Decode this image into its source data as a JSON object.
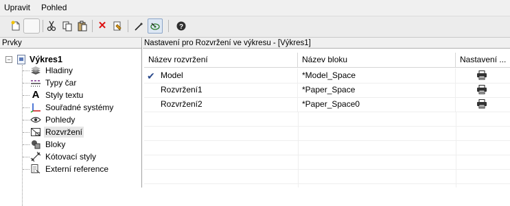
{
  "menu": {
    "items": [
      "Upravit",
      "Pohled"
    ]
  },
  "toolbar": {
    "buttons": [
      "new-icon",
      "blank-button",
      "cut-icon",
      "copy-icon",
      "paste-icon",
      "delete-icon",
      "properties-icon",
      "pick-icon",
      "preview-icon",
      "help-icon"
    ]
  },
  "left_panel": {
    "header": "Prvky",
    "root": {
      "label": "Výkres1",
      "expander": "−"
    },
    "items": [
      {
        "label": "Hladiny",
        "icon": "layers-icon",
        "selected": false
      },
      {
        "label": "Typy čar",
        "icon": "linetypes-icon",
        "selected": false
      },
      {
        "label": "Styly textu",
        "icon": "text-styles-icon",
        "selected": false
      },
      {
        "label": "Souřadné systémy",
        "icon": "coordinate-systems-icon",
        "selected": false
      },
      {
        "label": "Pohledy",
        "icon": "views-icon",
        "selected": false
      },
      {
        "label": "Rozvržení",
        "icon": "layouts-icon",
        "selected": true
      },
      {
        "label": "Bloky",
        "icon": "blocks-icon",
        "selected": false
      },
      {
        "label": "Kótovací styly",
        "icon": "dimension-styles-icon",
        "selected": false
      },
      {
        "label": "Externí reference",
        "icon": "external-references-icon",
        "selected": false
      }
    ]
  },
  "right_panel": {
    "header": "Nastavení pro Rozvržení ve výkresu - [Výkres1]",
    "columns": [
      "Název rozvržení",
      "Název bloku",
      "Nastavení ..."
    ],
    "rows": [
      {
        "name": "Model",
        "block": "*Model_Space",
        "current": true,
        "settings_icon": "printer-icon"
      },
      {
        "name": "Rozvržení1",
        "block": "*Paper_Space",
        "current": false,
        "settings_icon": "printer-icon"
      },
      {
        "name": "Rozvržení2",
        "block": "*Paper_Space0",
        "current": false,
        "settings_icon": "printer-icon"
      }
    ]
  },
  "colors": {
    "accent_check": "#2b4a8c",
    "selection_bg": "#e6e6e6",
    "toolbar_bg": "#ececec"
  }
}
